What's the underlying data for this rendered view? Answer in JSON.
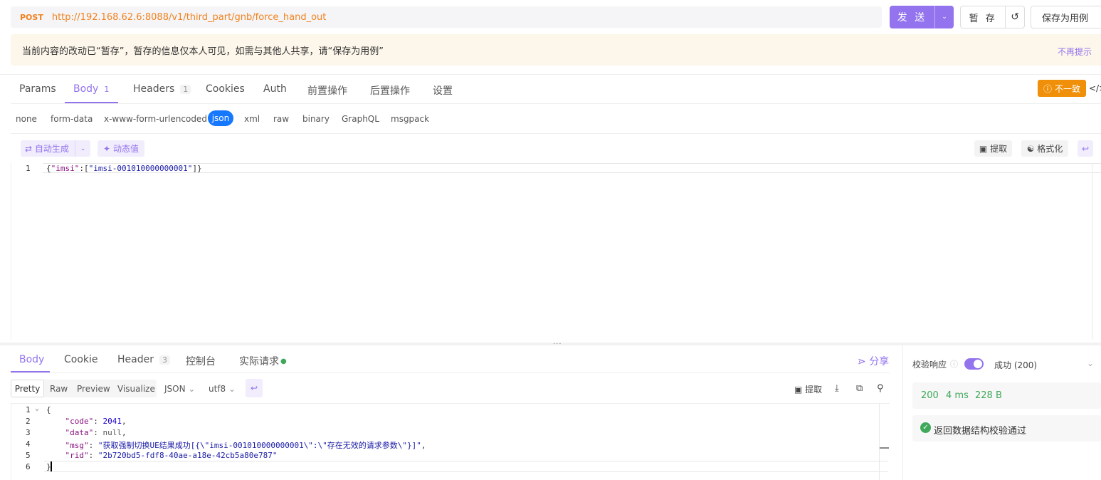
{
  "request": {
    "method": "POST",
    "url": "http://192.168.62.6:8088/v1/third_part/gnb/force_hand_out",
    "send_label": "发 送",
    "stash_label": "暂 存",
    "save_case_label": "保存为用例"
  },
  "notice": {
    "text": "当前内容的改动已“暂存”，暂存的信息仅本人可见，如需与其他人共享，请“保存为用例”",
    "dismiss": "不再提示"
  },
  "request_tabs": {
    "params": "Params",
    "body": "Body",
    "body_count": "1",
    "headers": "Headers",
    "headers_count": "1",
    "cookies": "Cookies",
    "auth": "Auth",
    "pre_ops": "前置操作",
    "post_ops": "后置操作",
    "settings": "设置",
    "mismatch": "不一致",
    "code_toggle": "</>"
  },
  "body_types": {
    "none": "none",
    "form_data": "form-data",
    "urlencoded": "x-www-form-urlencoded",
    "json": "json",
    "xml": "xml",
    "raw": "raw",
    "binary": "binary",
    "graphql": "GraphQL",
    "msgpack": "msgpack"
  },
  "editor_toolbar": {
    "auto_generate": "自动生成",
    "dynamic_value": "动态值",
    "extract": "提取",
    "format": "格式化"
  },
  "request_body": {
    "line_number": "1",
    "key": "imsi",
    "value": "imsi-001010000000001"
  },
  "response_tabs": {
    "body": "Body",
    "cookie": "Cookie",
    "header": "Header",
    "header_count": "3",
    "console": "控制台",
    "actual_request": "实际请求",
    "share": "分享"
  },
  "response_view": {
    "pretty": "Pretty",
    "raw": "Raw",
    "preview": "Preview",
    "visualize": "Visualize",
    "format": "JSON",
    "encoding": "utf8",
    "extract": "提取"
  },
  "response_body": {
    "line_numbers": [
      "1",
      "2",
      "3",
      "4",
      "5",
      "6"
    ],
    "code": "2041",
    "data": "null",
    "msg": "获取强制切换UE结果成功[{\\\"imsi-001010000000001\\\":\\\"存在无效的请求参数\\\"}]",
    "rid": "2b720bd5-fdf8-40ae-a18e-42cb5a80e787"
  },
  "validation": {
    "label": "校验响应",
    "status": "成功 (200)",
    "status_code": "200",
    "time": "4 ms",
    "size": "228 B",
    "result": "返回数据结构校验通过"
  }
}
